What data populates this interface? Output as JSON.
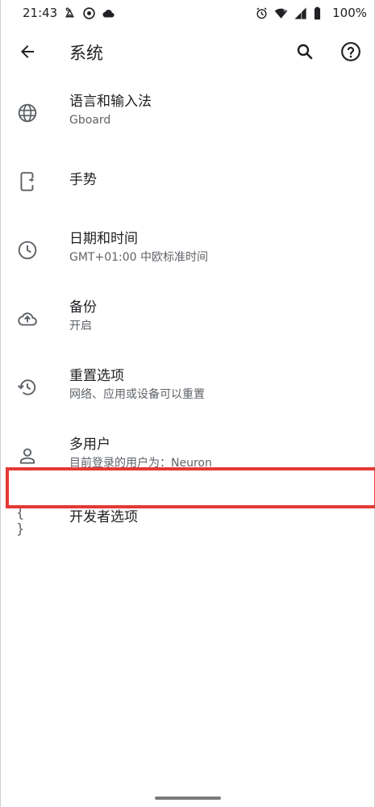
{
  "status_bar": {
    "time": "21:43",
    "battery": "100%",
    "left_icons": [
      "moon-cat-icon",
      "vpn-icon",
      "cloud-icon"
    ],
    "right_icons": [
      "alarm-icon",
      "wifi-icon",
      "signal-icon",
      "battery-icon"
    ]
  },
  "app_bar": {
    "title": "系统",
    "back_icon": "arrow-back-icon",
    "search_icon": "search-icon",
    "help_icon": "help-icon"
  },
  "settings": [
    {
      "label": "语言和输入法",
      "summary": "Gboard",
      "icon": "globe-icon"
    },
    {
      "label": "手势",
      "summary": "",
      "icon": "gesture-phone-icon"
    },
    {
      "label": "日期和时间",
      "summary": "GMT+01:00 中欧标准时间",
      "icon": "clock-icon"
    },
    {
      "label": "备份",
      "summary": "开启",
      "icon": "cloud-upload-icon"
    },
    {
      "label": "重置选项",
      "summary": "网络、应用或设备可以重置",
      "icon": "history-icon"
    },
    {
      "label": "多用户",
      "summary": "目前登录的用户为：Neuron",
      "icon": "person-icon"
    },
    {
      "label": "开发者选项",
      "summary": "",
      "icon": "code-braces-icon",
      "icon_glyph": "{ }"
    }
  ],
  "colors": {
    "highlight": "#e53935",
    "icon": "#5f6368",
    "primary_text": "#202124"
  }
}
